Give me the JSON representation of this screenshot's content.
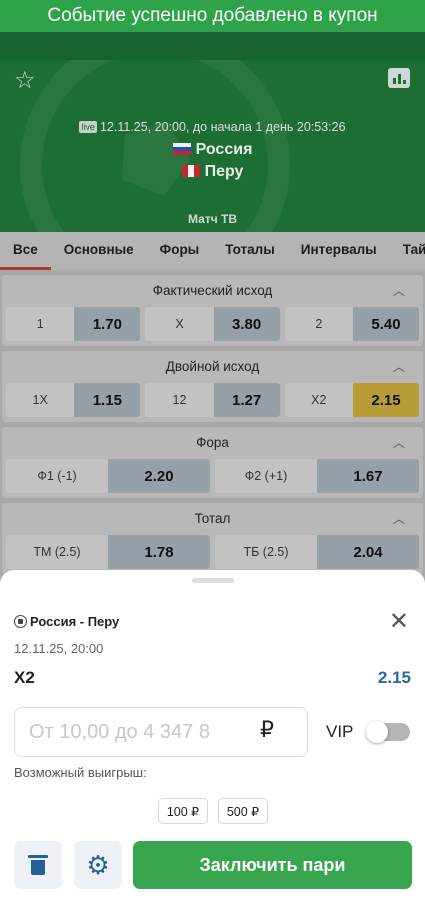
{
  "toast": "Событие успешно добавлено в купон",
  "match": {
    "live_badge": "live",
    "datetime": "12.11.25, 20:00, до начала  1 день  20:53:26",
    "team1": "Россия",
    "team2": "Перу",
    "match_tv": "Матч ТВ"
  },
  "tabs": [
    "Все",
    "Основные",
    "Форы",
    "Тоталы",
    "Интервалы",
    "Тайм"
  ],
  "groups": {
    "g1": {
      "title": "Фактический исход",
      "items": [
        {
          "label": "1",
          "odd": "1.70"
        },
        {
          "label": "X",
          "odd": "3.80"
        },
        {
          "label": "2",
          "odd": "5.40"
        }
      ]
    },
    "g2": {
      "title": "Двойной исход",
      "items": [
        {
          "label": "1X",
          "odd": "1.15"
        },
        {
          "label": "12",
          "odd": "1.27"
        },
        {
          "label": "X2",
          "odd": "2.15"
        }
      ]
    },
    "g3": {
      "title": "Фора",
      "items": [
        {
          "label": "Ф1 (-1)",
          "odd": "2.20"
        },
        {
          "label": "Ф2 (+1)",
          "odd": "1.67"
        }
      ]
    },
    "g4": {
      "title": "Тотал",
      "items": [
        {
          "label": "ТМ (2.5)",
          "odd": "1.78"
        },
        {
          "label": "ТБ (2.5)",
          "odd": "2.04"
        }
      ]
    }
  },
  "coupon": {
    "title": "Россия - Перу",
    "date": "12.11.25,  20:00",
    "bet_type": "X2",
    "bet_odd": "2.15",
    "stake_placeholder": "От 10,00 до 4 347 8",
    "currency": "₽",
    "vip_label": "VIP",
    "win_label": "Возможный выигрыш:",
    "quick_amounts": [
      "100 ₽",
      "500 ₽"
    ],
    "submit_label": "Заключить пари"
  },
  "icons": {
    "favorite": "star-icon",
    "stats": "stats-icon",
    "close": "close-icon",
    "delete": "trash-icon",
    "settings": "gear-icon"
  },
  "colors": {
    "brand_green": "#37a64e",
    "odd_blue": "#2a6aa0",
    "selected_odd": "#f3cf55"
  }
}
